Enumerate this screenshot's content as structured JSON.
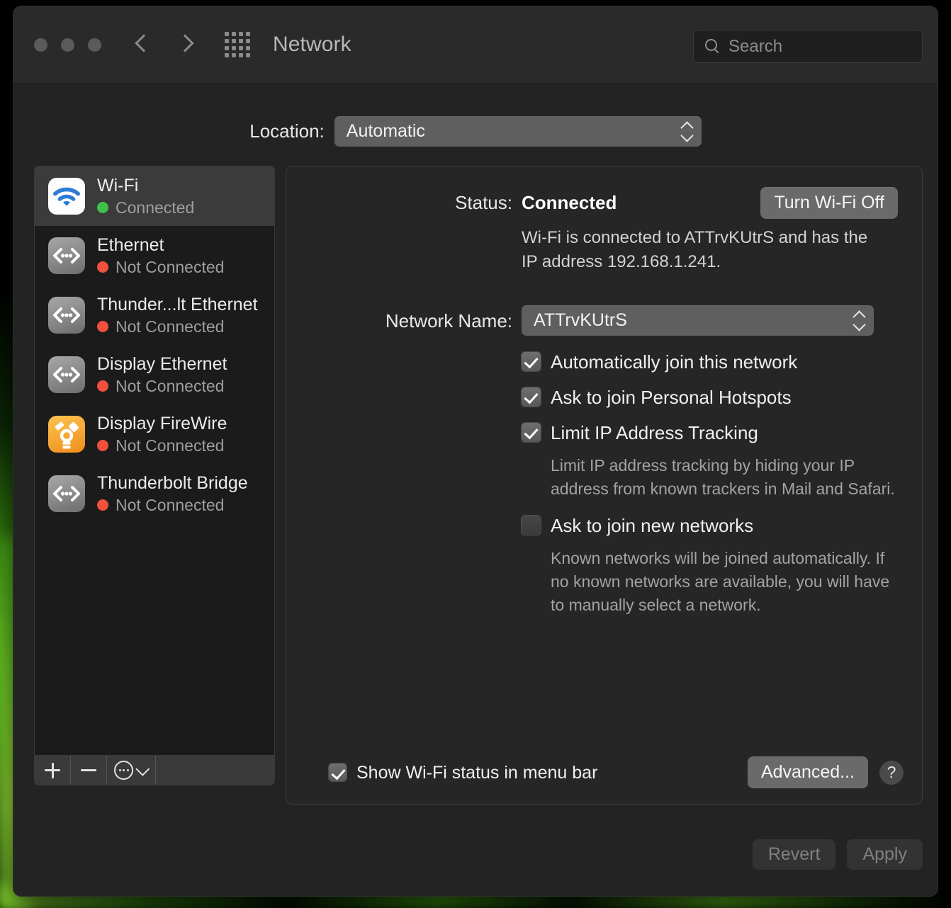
{
  "window": {
    "title": "Network",
    "traffic_lights": [
      "close",
      "minimize",
      "zoom"
    ],
    "nav": {
      "back": "back-chevron",
      "forward": "forward-chevron",
      "show_all": "grid-icon"
    },
    "search": {
      "placeholder": "Search",
      "value": "",
      "icon": "search-icon"
    }
  },
  "location": {
    "label": "Location:",
    "value": "Automatic",
    "options": [
      "Automatic"
    ]
  },
  "sidebar": {
    "services": [
      {
        "name": "Wi-Fi",
        "status": "Connected",
        "status_color": "#3fc24a",
        "icon": "wifi-icon",
        "selected": true
      },
      {
        "name": "Ethernet",
        "status": "Not Connected",
        "status_color": "#f0503c",
        "icon": "ethernet-icon",
        "selected": false
      },
      {
        "name": "Thunder...lt Ethernet",
        "status": "Not Connected",
        "status_color": "#f0503c",
        "icon": "ethernet-icon",
        "selected": false
      },
      {
        "name": "Display Ethernet",
        "status": "Not Connected",
        "status_color": "#f0503c",
        "icon": "ethernet-icon",
        "selected": false
      },
      {
        "name": "Display FireWire",
        "status": "Not Connected",
        "status_color": "#f0503c",
        "icon": "firewire-icon",
        "selected": false
      },
      {
        "name": "Thunderbolt Bridge",
        "status": "Not Connected",
        "status_color": "#f0503c",
        "icon": "ethernet-icon",
        "selected": false
      }
    ],
    "toolbar": {
      "add": "+",
      "remove": "−",
      "actions_icon": "ellipsis-circle-icon",
      "actions_caret": "chevron-down-icon"
    }
  },
  "detail": {
    "status_label": "Status:",
    "status_value": "Connected",
    "turn_off_button": "Turn Wi-Fi Off",
    "status_description": "Wi-Fi is connected to ATTrvKUtrS and has the IP address 192.168.1.241.",
    "network_name_label": "Network Name:",
    "network_name_value": "ATTrvKUtrS",
    "checkboxes": [
      {
        "label": "Automatically join this network",
        "checked": true,
        "help": ""
      },
      {
        "label": "Ask to join Personal Hotspots",
        "checked": true,
        "help": ""
      },
      {
        "label": "Limit IP Address Tracking",
        "checked": true,
        "help": "Limit IP address tracking by hiding your IP address from known trackers in Mail and Safari."
      },
      {
        "label": "Ask to join new networks",
        "checked": false,
        "help": "Known networks will be joined automatically. If no known networks are available, you will have to manually select a network."
      }
    ],
    "menu_bar_checkbox": {
      "label": "Show Wi-Fi status in menu bar",
      "checked": true
    },
    "advanced_button": "Advanced...",
    "help_button": "?"
  },
  "footer": {
    "revert_button": "Revert",
    "apply_button": "Apply"
  },
  "colors": {
    "accent_blue": "#2f7cd6",
    "connected_green": "#3fc24a",
    "disconnected_red": "#f0503c",
    "firewire_orange": "#ef8f1c",
    "window_bg": "#232323",
    "panel_bg": "#262626"
  }
}
